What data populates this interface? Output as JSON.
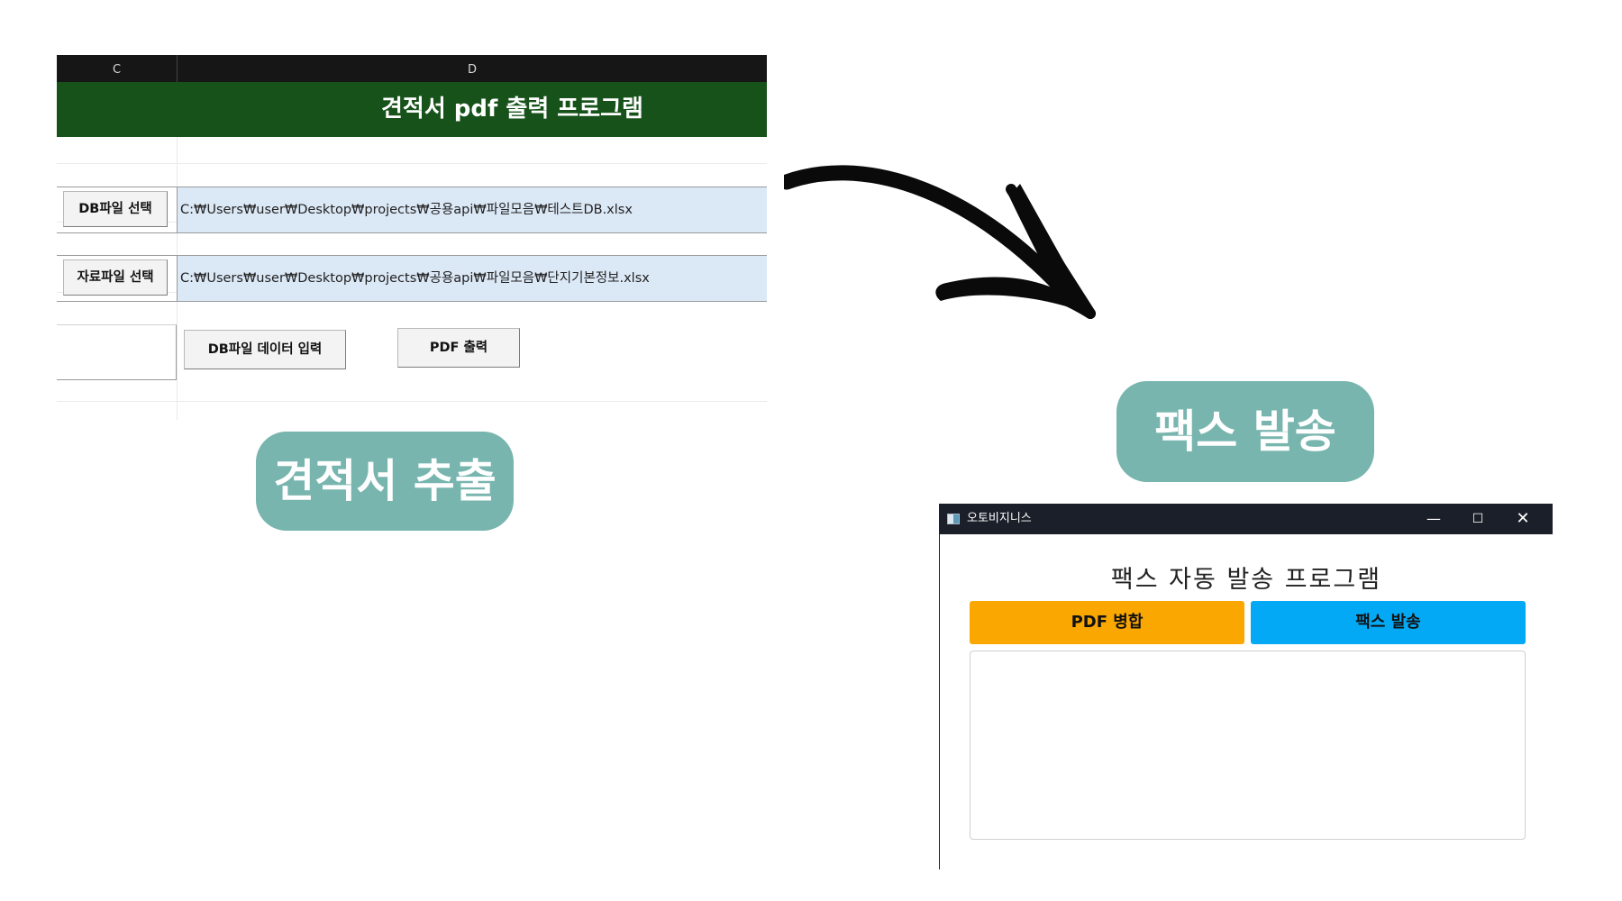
{
  "sheet": {
    "columns": [
      "C",
      "D"
    ],
    "title": "견적서 pdf 출력 프로그램",
    "rows": [
      {
        "button": "DB파일 선택",
        "path": "C:₩Users₩user₩Desktop₩projects₩공용api₩파일모음₩테스트DB.xlsx"
      },
      {
        "button": "자료파일 선택",
        "path": "C:₩Users₩user₩Desktop₩projects₩공용api₩파일모음₩단지기본정보.xlsx"
      }
    ],
    "actions": {
      "db_input": "DB파일 데이터 입력",
      "pdf_output": "PDF 출력"
    }
  },
  "labels": {
    "extract": "견적서 추출",
    "fax": "팩스 발송"
  },
  "fax_window": {
    "title": "오토비지니스",
    "heading": "팩스 자동 발송 프로그램",
    "merge_button": "PDF 병합",
    "send_button": "팩스 발송",
    "log": ""
  },
  "icons": {
    "minimize": "minimize-icon",
    "maximize": "maximize-icon",
    "close": "close-icon",
    "arrow": "curved-arrow-icon"
  },
  "colors": {
    "sheet_title_bg": "#17521b",
    "path_cell_bg": "#dbe8f6",
    "pill_bg": "#77b5ae",
    "merge_button": "#fba701",
    "send_button": "#04a9f6",
    "titlebar_bg": "#1b1f29"
  }
}
